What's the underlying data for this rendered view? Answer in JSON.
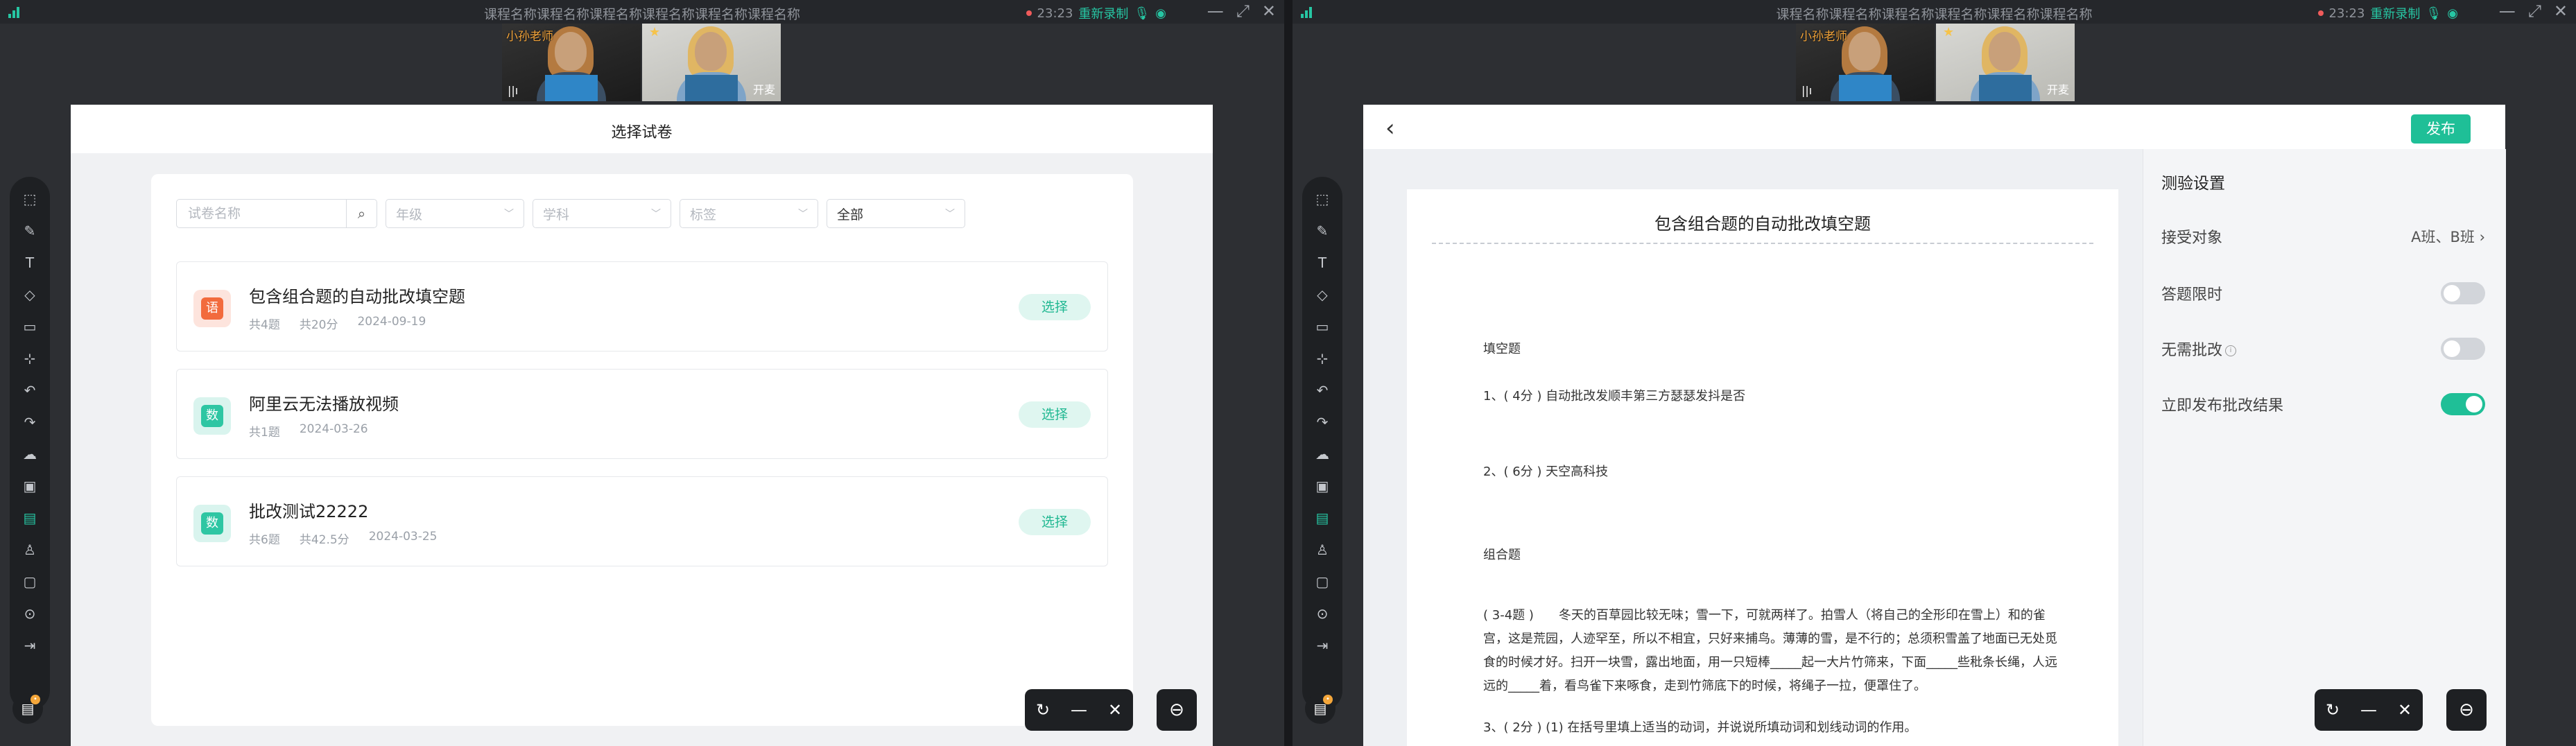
{
  "window": {
    "title": "课程名称课程名称课程名称课程名称课程名称课程名称",
    "time": "23:23",
    "rerecord_label": "重新录制"
  },
  "video": {
    "teacher_name": "小孙老师",
    "mic_open_label": "开麦"
  },
  "left_screen": {
    "header_title": "选择试卷",
    "filters": {
      "name_placeholder": "试卷名称",
      "grade_placeholder": "年级",
      "subject_placeholder": "学科",
      "tag_placeholder": "标签",
      "scope_value": "全部"
    },
    "items": [
      {
        "subject": "语",
        "title": "包含组合题的自动批改填空题",
        "count": "共4题",
        "score": "共20分",
        "date": "2024-09-19",
        "action": "选择"
      },
      {
        "subject": "数",
        "title": "阿里云无法播放视频",
        "count": "共1题",
        "score": "",
        "date": "2024-03-26",
        "action": "选择"
      },
      {
        "subject": "数",
        "title": "批改测试22222",
        "count": "共6题",
        "score": "共42.5分",
        "date": "2024-03-25",
        "action": "选择"
      }
    ]
  },
  "right_screen": {
    "publish_label": "发布",
    "paper": {
      "title": "包含组合题的自动批改填空题",
      "section1": "填空题",
      "q1": "1、( 4分 ) 自动批改发顺丰第三方瑟瑟发抖是否",
      "q2": "2、( 6分 ) 天空高科技",
      "section2": "组合题",
      "passage": "( 3-4题 )　　冬天的百草园比较无味；雪一下，可就两样了。拍雪人（将自己的全形印在雪上）和的雀宫，这是荒园，人迹罕至，所以不相宜，只好来捕鸟。薄薄的雪，是不行的；总须积雪盖了地面已无处觅食的时候才好。扫开一块雪，露出地面，用一只短棒_____起一大片竹筛来，下面_____些秕条长绳，人远远的_____着，看鸟雀下来啄食，走到竹筛底下的时候，将绳子一拉，便罩住了。",
      "q3": "3、( 2分 ) (1) 在括号里填上适当的动词，并说说所填动词和划线动词的作用。"
    },
    "settings": {
      "title": "测验设置",
      "target_label": "接受对象",
      "target_value": "A班、B班",
      "time_limit_label": "答题限时",
      "time_limit_on": false,
      "no_review_label": "无需批改",
      "no_review_on": false,
      "publish_result_label": "立即发布批改结果",
      "publish_result_on": true
    }
  },
  "colors": {
    "accent": "#1fbf97",
    "background": "#2d2f33",
    "toolbar": "#1e2023"
  },
  "icons": [
    "select-icon",
    "pen-icon",
    "text-icon",
    "eraser-icon",
    "shape-icon",
    "laser-icon",
    "undo-icon",
    "redo-icon",
    "cloud-upload-icon",
    "image-icon",
    "toolbox-icon",
    "person-icon",
    "chat-icon",
    "settings-icon",
    "exit-icon",
    "refresh-icon",
    "minimize-icon",
    "close-icon",
    "collapse-icon"
  ]
}
